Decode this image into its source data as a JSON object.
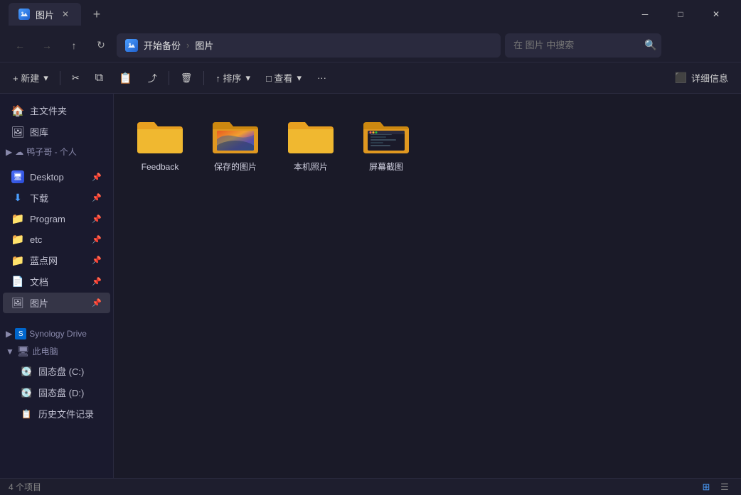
{
  "titlebar": {
    "tab_icon": "🖼",
    "tab_label": "图片",
    "new_tab_label": "+",
    "minimize_icon": "─",
    "maximize_icon": "□",
    "close_icon": "✕"
  },
  "navbar": {
    "back_icon": "←",
    "forward_icon": "→",
    "up_icon": "↑",
    "refresh_icon": "↻",
    "breadcrumb_icon": "☁",
    "breadcrumb_root": "开始备份",
    "breadcrumb_sep": "›",
    "breadcrumb_current": "图片",
    "search_placeholder": "在 图片 中搜索",
    "search_icon": "🔍"
  },
  "toolbar": {
    "new_label": "+ 新建",
    "new_dropdown": "▾",
    "cut_icon": "✂",
    "copy_icon": "⧉",
    "paste_icon": "📋",
    "share_icon": "⤴",
    "delete_icon": "🗑",
    "sort_label": "↑ 排序",
    "sort_dropdown": "▾",
    "view_label": "□ 查看",
    "view_dropdown": "▾",
    "more_icon": "···",
    "details_label": "详细信息"
  },
  "sidebar": {
    "home_label": "主文件夹",
    "gallery_label": "图库",
    "cloud_label": "鸭子哥 - 个人",
    "pinned_items": [
      {
        "label": "Desktop",
        "icon": "💻",
        "pinned": true
      },
      {
        "label": "下载",
        "icon": "⬇",
        "pinned": true
      },
      {
        "label": "Program",
        "icon": "📁",
        "pinned": true
      },
      {
        "label": "etc",
        "icon": "📁",
        "pinned": true
      },
      {
        "label": "蓝点网",
        "icon": "📁",
        "pinned": true
      },
      {
        "label": "文档",
        "icon": "📄",
        "pinned": true
      },
      {
        "label": "图片",
        "icon": "🖼",
        "pinned": true
      }
    ],
    "synology_label": "Synology Drive",
    "pc_label": "此电脑",
    "drive_c_label": "固态盘 (C:)",
    "drive_d_label": "固态盘 (D:)",
    "history_label": "历史文件记录"
  },
  "folders": [
    {
      "name": "Feedback",
      "type": "plain"
    },
    {
      "name": "保存的图片",
      "type": "photos"
    },
    {
      "name": "本机照片",
      "type": "plain"
    },
    {
      "name": "屏幕截图",
      "type": "screenshot"
    }
  ],
  "statusbar": {
    "count_label": "4 个项目",
    "grid_icon": "⊞",
    "list_icon": "☰"
  }
}
